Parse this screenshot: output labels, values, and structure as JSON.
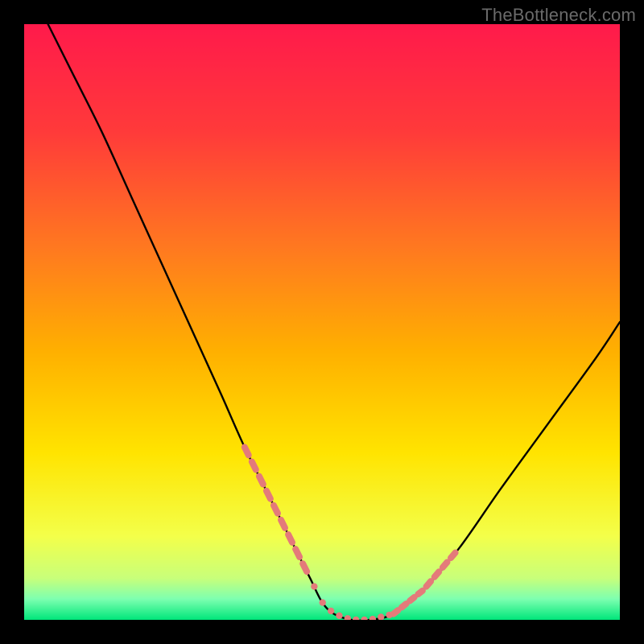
{
  "watermark": "TheBottleneck.com",
  "chart_data": {
    "type": "line",
    "title": "",
    "xlabel": "",
    "ylabel": "",
    "xlim": [
      0,
      100
    ],
    "ylim": [
      0,
      100
    ],
    "gradient_stops": [
      {
        "offset": 0.0,
        "color": "#ff1a4b"
      },
      {
        "offset": 0.18,
        "color": "#ff3a3a"
      },
      {
        "offset": 0.38,
        "color": "#ff7a1f"
      },
      {
        "offset": 0.55,
        "color": "#ffb000"
      },
      {
        "offset": 0.72,
        "color": "#ffe400"
      },
      {
        "offset": 0.86,
        "color": "#f3ff4a"
      },
      {
        "offset": 0.93,
        "color": "#c8ff7a"
      },
      {
        "offset": 0.965,
        "color": "#7dffb0"
      },
      {
        "offset": 1.0,
        "color": "#00e67a"
      }
    ],
    "series": [
      {
        "name": "bottleneck-curve",
        "x": [
          4,
          8,
          13,
          18,
          23,
          28,
          33,
          37,
          41,
          45,
          48,
          50,
          52,
          55,
          58,
          62,
          67,
          73,
          80,
          88,
          96,
          100
        ],
        "y": [
          100,
          92,
          82,
          71,
          60,
          49,
          38,
          29,
          21,
          13,
          7,
          3,
          1,
          0,
          0,
          1,
          5,
          12,
          22,
          33,
          44,
          50
        ]
      }
    ],
    "dash_segments": {
      "left": {
        "x_range": [
          37,
          48
        ],
        "count": 9
      },
      "right": {
        "x_range": [
          62,
          73
        ],
        "count": 8
      },
      "floor_dots": {
        "x_range": [
          48,
          62
        ],
        "count": 10
      }
    },
    "colors": {
      "curve": "#000000",
      "dash": "#e47a7a",
      "background_frame": "#000000"
    }
  }
}
